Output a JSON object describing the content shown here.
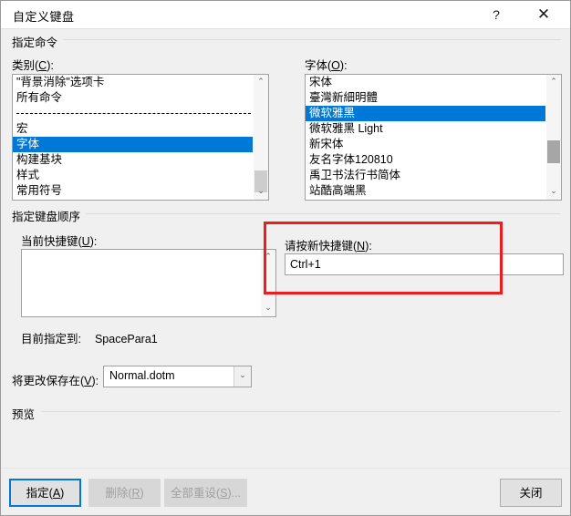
{
  "window": {
    "title": "自定义键盘",
    "help_label": "?",
    "close_label": "✕"
  },
  "groups": {
    "assign_command": "指定命令",
    "keyboard_sequence": "指定键盘顺序",
    "preview": "预览"
  },
  "category": {
    "label": "类别(C):",
    "label_main": "类别(",
    "label_acc": "C",
    "label_tail": "):",
    "items": [
      {
        "text": "\"背景消除\"选项卡",
        "selected": false,
        "separator": false
      },
      {
        "text": "所有命令",
        "selected": false,
        "separator": false
      },
      {
        "text": "",
        "selected": false,
        "separator": true
      },
      {
        "text": "宏",
        "selected": false,
        "separator": false
      },
      {
        "text": "字体",
        "selected": true,
        "separator": false
      },
      {
        "text": "构建基块",
        "selected": false,
        "separator": false
      },
      {
        "text": "样式",
        "selected": false,
        "separator": false
      },
      {
        "text": "常用符号",
        "selected": false,
        "separator": false
      }
    ]
  },
  "fonts": {
    "label": "字体(O):",
    "label_main": "字体(",
    "label_acc": "O",
    "label_tail": "):",
    "items": [
      {
        "text": "宋体",
        "selected": false,
        "separator": false
      },
      {
        "text": "臺灣新細明體",
        "selected": false,
        "separator": false
      },
      {
        "text": "微软雅黑",
        "selected": true,
        "separator": false
      },
      {
        "text": "微软雅黑 Light",
        "selected": false,
        "separator": false
      },
      {
        "text": "新宋体",
        "selected": false,
        "separator": false
      },
      {
        "text": "友名字体120810",
        "selected": false,
        "separator": false
      },
      {
        "text": "禹卫书法行书简体",
        "selected": false,
        "separator": false
      },
      {
        "text": "站酷高端黑",
        "selected": false,
        "separator": false
      }
    ]
  },
  "current_keys": {
    "label_main": "当前快捷键(",
    "label_acc": "U",
    "label_tail": "):",
    "items": []
  },
  "new_key": {
    "label_main": "请按新快捷键(",
    "label_acc": "N",
    "label_tail": "):",
    "value": "Ctrl+1"
  },
  "assigned_to": {
    "prefix": "目前指定到:",
    "value": "SpacePara1"
  },
  "save_in": {
    "label_main": "将更改保存在(",
    "label_acc": "V",
    "label_tail": "):",
    "value": "Normal.dotm",
    "arrow": "⌄"
  },
  "buttons": {
    "assign_main": "指定(",
    "assign_acc": "A",
    "assign_tail": ")",
    "remove_main": "删除(",
    "remove_acc": "R",
    "remove_tail": ")",
    "reset_main": "全部重设(",
    "reset_acc": "S",
    "reset_tail": ")...",
    "close": "关闭"
  },
  "scroll": {
    "up_arrow": "⌃",
    "down_arrow": "⌄"
  },
  "colors": {
    "selection": "#0078d7",
    "annotation": "#ee1c1c",
    "dialog_bg": "#f0f0f0"
  }
}
